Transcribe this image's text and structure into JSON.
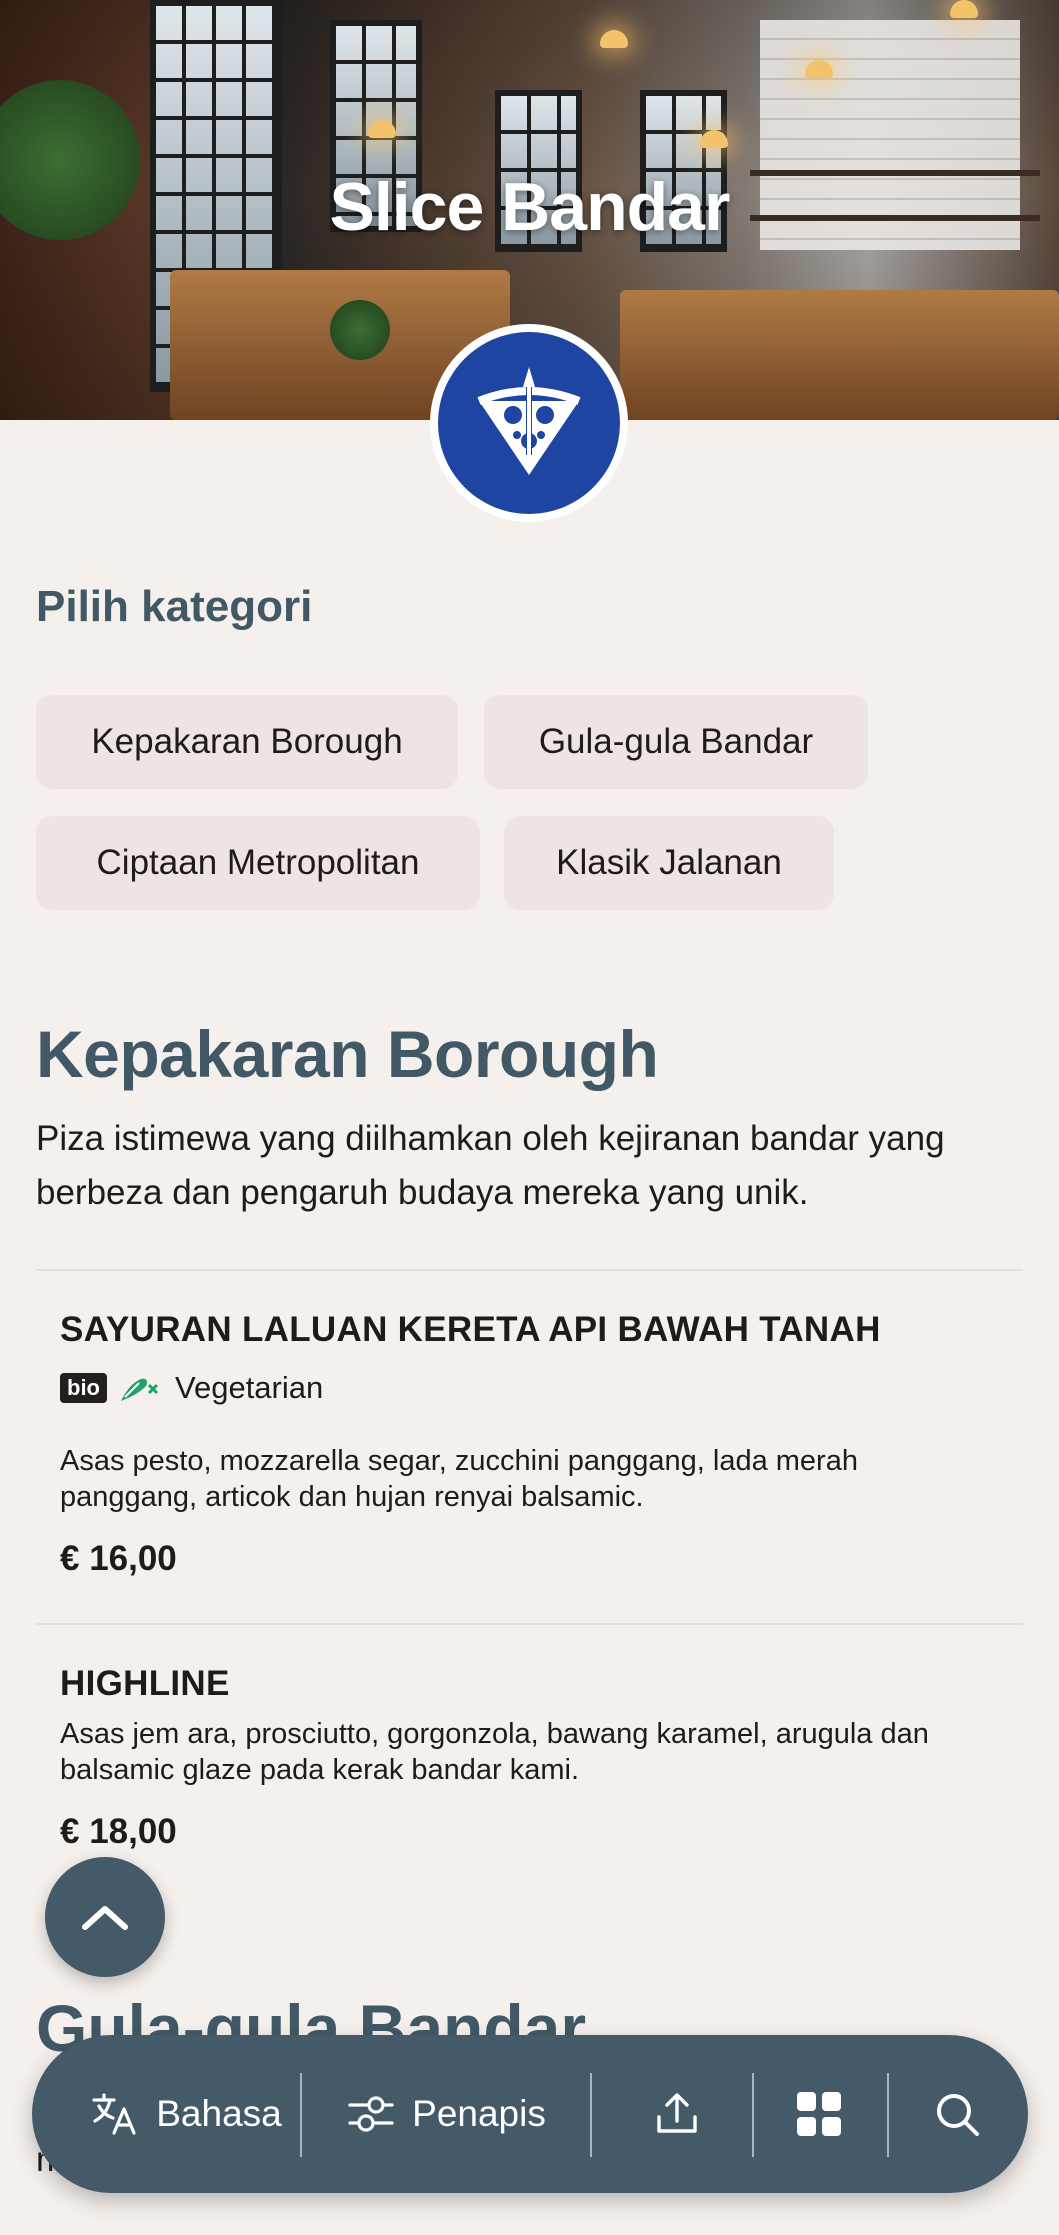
{
  "header": {
    "restaurant_name": "Slice Bandar",
    "logo_icon": "pizza-slice-logo-icon"
  },
  "categories": {
    "label": "Pilih kategori",
    "chips": [
      {
        "label": "Kepakaran Borough"
      },
      {
        "label": "Gula-gula Bandar"
      },
      {
        "label": "Ciptaan Metropolitan"
      },
      {
        "label": "Klasik Jalanan"
      }
    ]
  },
  "section": {
    "title": "Kepakaran Borough",
    "description": "Piza istimewa yang diilhamkan oleh kejiranan bandar yang berbeza dan pengaruh budaya mereka yang unik.",
    "items": [
      {
        "name": "SAYURAN LALUAN KERETA API BAWAH TANAH",
        "badge": "bio",
        "diet_label": "Vegetarian",
        "description": "Asas pesto, mozzarella segar, zucchini panggang, lada merah panggang, articok dan hujan renyai balsamic.",
        "price": "€ 16,00"
      },
      {
        "name": "HIGHLINE",
        "description": "Asas jem ara, prosciutto, gorgonzola, bawang karamel, arugula dan balsamic glaze pada kerak bandar kami.",
        "price": "€ 18,00"
      }
    ]
  },
  "next_section": {
    "title": "Gula-gula Bandar",
    "description_fragment": "m"
  },
  "bottom_bar": {
    "language_label": "Bahasa",
    "filter_label": "Penapis"
  },
  "colors": {
    "accent": "#415866",
    "bar": "#445a68",
    "background": "#f6f0ec",
    "chip": "#ece5e1",
    "logo_blue": "#1f45a2",
    "veg_green": "#1fa36a"
  }
}
